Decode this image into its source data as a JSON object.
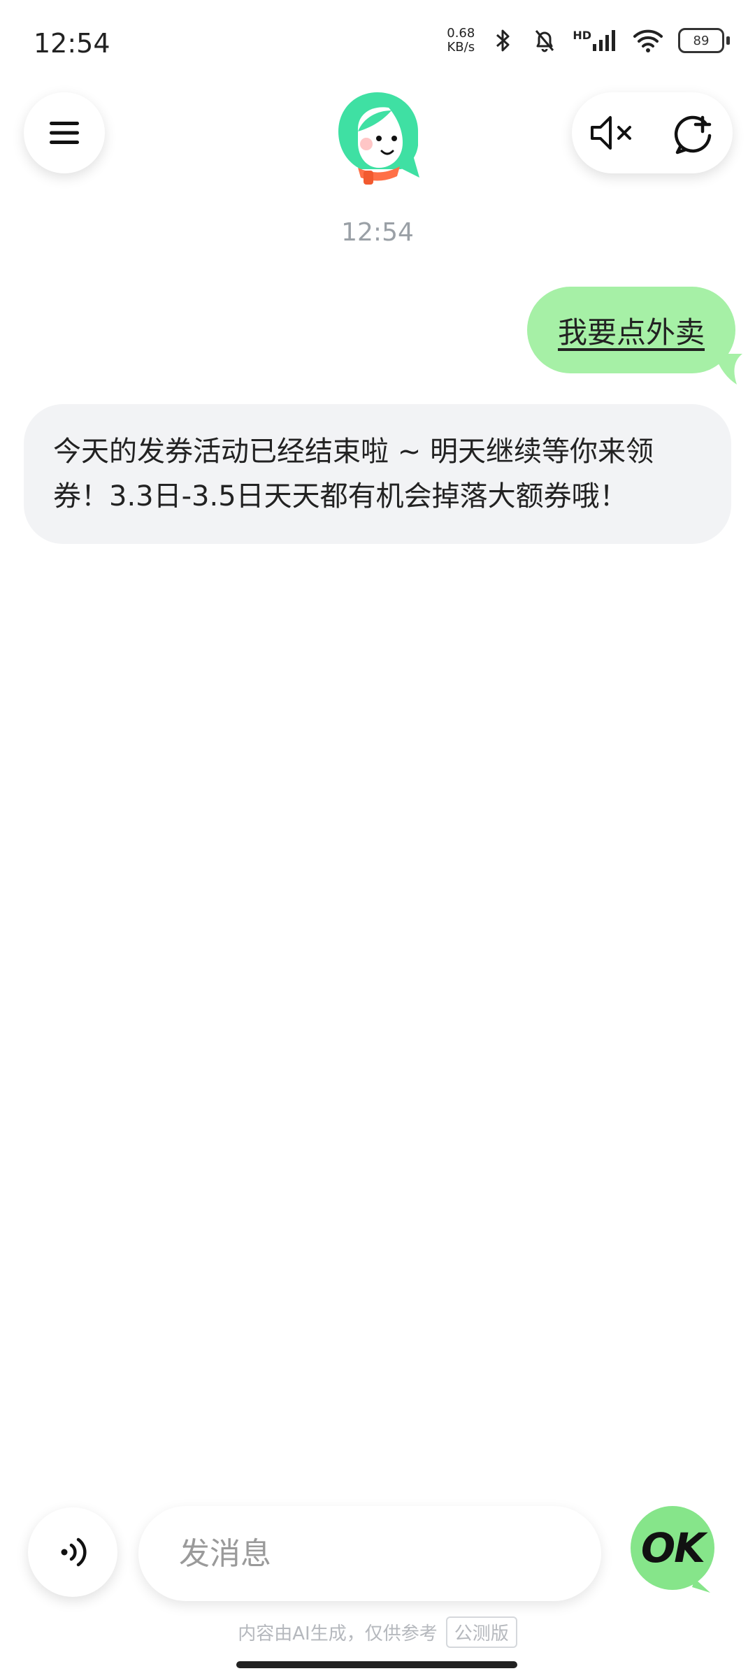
{
  "status_bar": {
    "time": "12:54",
    "net_speed_value": "0.68",
    "net_speed_unit": "KB/s",
    "signal_label": "HD",
    "battery": "89"
  },
  "header": {
    "menu_icon": "menu-icon",
    "mute_icon": "speaker-muted-icon",
    "new_chat_icon": "new-chat-icon",
    "avatar": "assistant-avatar"
  },
  "chat": {
    "timestamp": "12:54",
    "messages": [
      {
        "role": "user",
        "text": "我要点外卖"
      },
      {
        "role": "assistant",
        "text": "今天的发券活动已经结束啦 ~ 明天继续等你来领券！3.3日-3.5日天天都有机会掉落大额券哦！"
      }
    ]
  },
  "composer": {
    "placeholder": "发消息",
    "ok_label": "OK"
  },
  "footer": {
    "disclaimer": "内容由AI生成，仅供参考",
    "beta_tag": "公测版"
  },
  "colors": {
    "user_bubble": "#a6f0a6",
    "bot_bubble": "#f2f3f5",
    "accent_green": "#86e58a"
  }
}
